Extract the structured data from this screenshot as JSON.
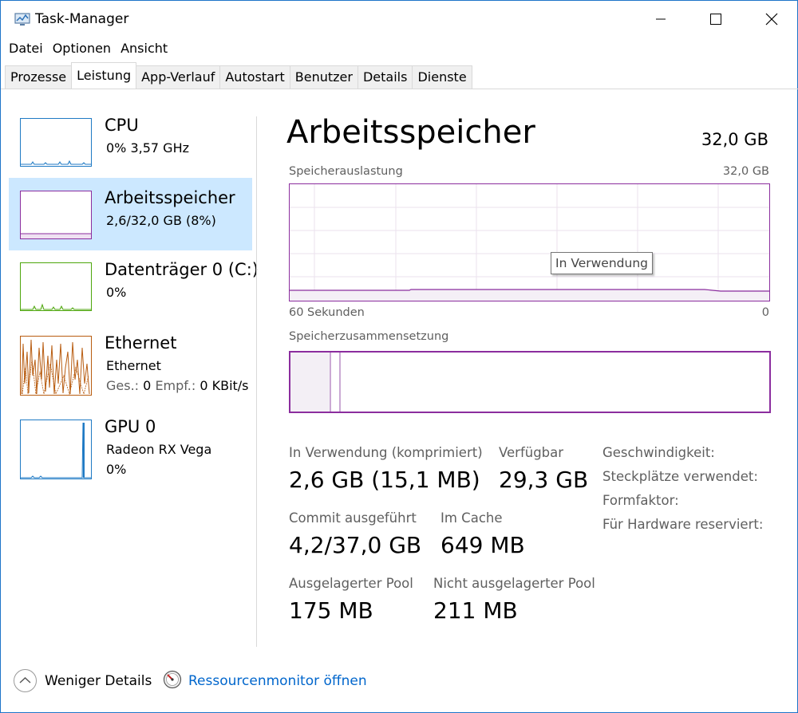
{
  "window": {
    "title": "Task-Manager"
  },
  "menu": [
    "Datei",
    "Optionen",
    "Ansicht"
  ],
  "tabs": [
    "Prozesse",
    "Leistung",
    "App-Verlauf",
    "Autostart",
    "Benutzer",
    "Details",
    "Dienste"
  ],
  "active_tab": "Leistung",
  "sidebar": {
    "cpu": {
      "title": "CPU",
      "sub": "0%  3,57 GHz",
      "color": "#1f7ac4"
    },
    "memory": {
      "title": "Arbeitsspeicher",
      "sub": "2,6/32,0 GB (8%)",
      "color": "#8b2d9e"
    },
    "disk": {
      "title": "Datenträger 0 (C:)",
      "sub": "0%",
      "color": "#4da60c"
    },
    "ethernet": {
      "title": "Ethernet",
      "sub": "Ethernet",
      "send_label": "Ges.:",
      "send_value": "0",
      "recv_label": "Empf.:",
      "recv_value": "0 KBit/s",
      "color": "#b85c10"
    },
    "gpu": {
      "title": "GPU 0",
      "sub": "Radeon RX Vega",
      "sub2": "0%",
      "color": "#1f7ac4"
    }
  },
  "main": {
    "title": "Arbeitsspeicher",
    "total": "32,0 GB",
    "usage_label": "Speicherauslastung",
    "usage_max": "32,0 GB",
    "axis_left": "60 Sekunden",
    "axis_right": "0",
    "tooltip": "In Verwendung",
    "composition_label": "Speicherzusammensetzung",
    "usage_fraction": 0.08
  },
  "stats": {
    "in_use_label": "In Verwendung (komprimiert)",
    "in_use_value": "2,6 GB (15,1 MB)",
    "available_label": "Verfügbar",
    "available_value": "29,3 GB",
    "commit_label": "Commit ausgeführt",
    "commit_value": "4,2/37,0 GB",
    "cache_label": "Im Cache",
    "cache_value": "649 MB",
    "paged_label": "Ausgelagerter Pool",
    "paged_value": "175 MB",
    "nonpaged_label": "Nicht ausgelagerter Pool",
    "nonpaged_value": "211 MB"
  },
  "properties": [
    "Geschwindigkeit:",
    "Steckplätze verwendet:",
    "Formfaktor:",
    "Für Hardware reserviert:"
  ],
  "footer": {
    "fewer_details": "Weniger Details",
    "resource_monitor": "Ressourcenmonitor öffnen"
  }
}
